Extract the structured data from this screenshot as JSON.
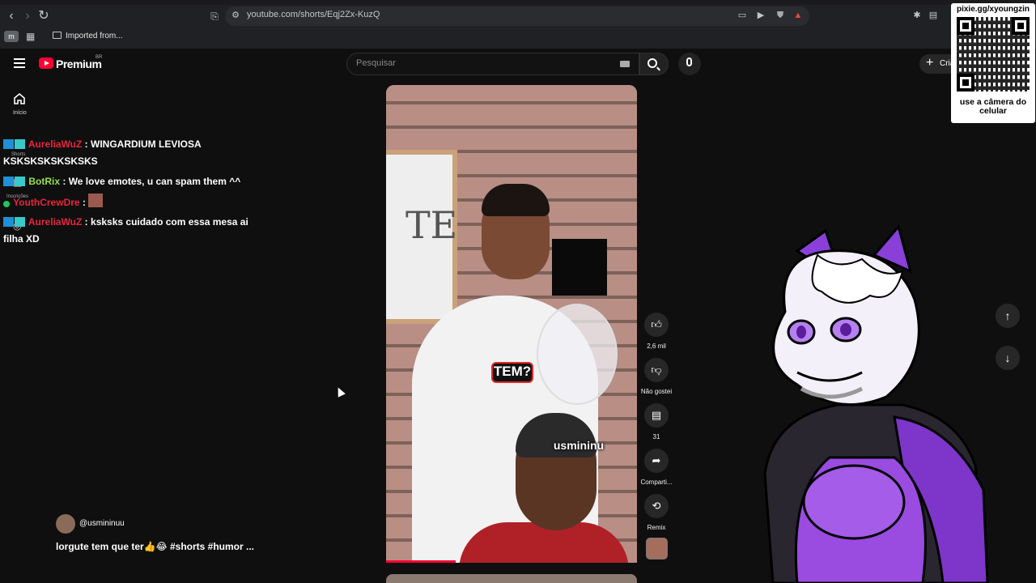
{
  "browser": {
    "url": "youtube.com/shorts/Eqj2Zx-KuzQ",
    "bookmark_m": "m",
    "bookmark_folder": "Imported from..."
  },
  "header": {
    "brand": "Premium",
    "country": "BR",
    "search_placeholder": "Pesquisar",
    "create_label": "Cria"
  },
  "sidebar": {
    "home_label": "Início",
    "shorts_label": "Shorts",
    "subs_label": "Inscrições"
  },
  "chat": [
    {
      "user": "AureliaWuZ",
      "color": "#e8243d",
      "message": "WINGARDIUM LEVIOSA KSKSKSKSKSKSKS"
    },
    {
      "user": "BotRix",
      "color": "#9bde4f",
      "message": "We love emotes, u can spam them ^^"
    },
    {
      "user": "YouthCrewDre",
      "color": "#e8243d",
      "message": ""
    },
    {
      "user": "AureliaWuZ",
      "color": "#e8243d",
      "message": "ksksks cuidado com essa mesa ai filha XD"
    }
  ],
  "video": {
    "caption_bubble": "TEM?",
    "caption_handle": "usmininu",
    "channel": "@usmininuu",
    "title": "lorgute tem que ter👍😂 #shorts #humor ..."
  },
  "actions": {
    "likes": "2,6 mil",
    "dislike": "Não gostei",
    "comments": "31",
    "share": "Comparti...",
    "remix": "Remix"
  },
  "overlay": {
    "qr_top": "pixie.gg/xyoungzin",
    "qr_bottom": "use a câmera do celular"
  }
}
